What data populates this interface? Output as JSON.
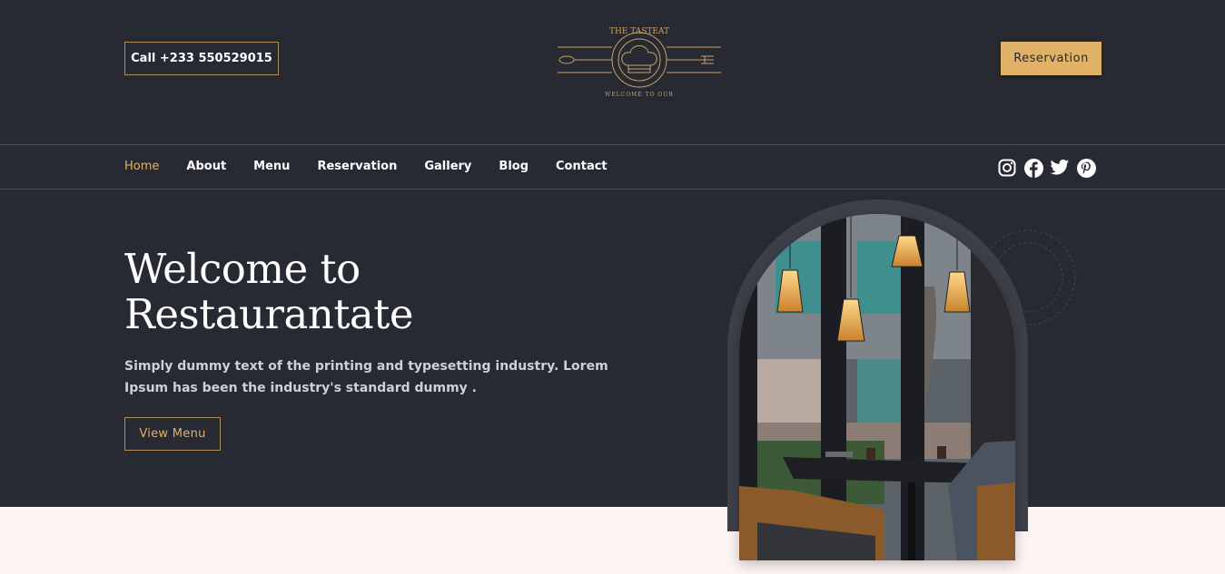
{
  "header": {
    "call_label": "Call +233 550529015",
    "reservation_label": "Reservation",
    "logo": {
      "top_text": "THE TASTEAT",
      "bottom_text": "WELCOME TO OUR"
    }
  },
  "nav": {
    "items": [
      {
        "label": "Home",
        "active": true
      },
      {
        "label": "About"
      },
      {
        "label": "Menu"
      },
      {
        "label": "Reservation"
      },
      {
        "label": "Gallery"
      },
      {
        "label": "Blog"
      },
      {
        "label": "Contact"
      }
    ],
    "social_icons": [
      "instagram-icon",
      "facebook-icon",
      "twitter-icon",
      "pinterest-icon"
    ]
  },
  "hero": {
    "title_line1": "Welcome to",
    "title_line2": "Restaurantate",
    "text": "Simply dummy text of the printing and typesetting industry. Lorem Ipsum has been the industry's standard dummy .",
    "button_label": "View Menu"
  },
  "colors": {
    "background_dark": "#272a33",
    "accent_gold": "#e1b168",
    "cream": "#fdf5f3"
  }
}
